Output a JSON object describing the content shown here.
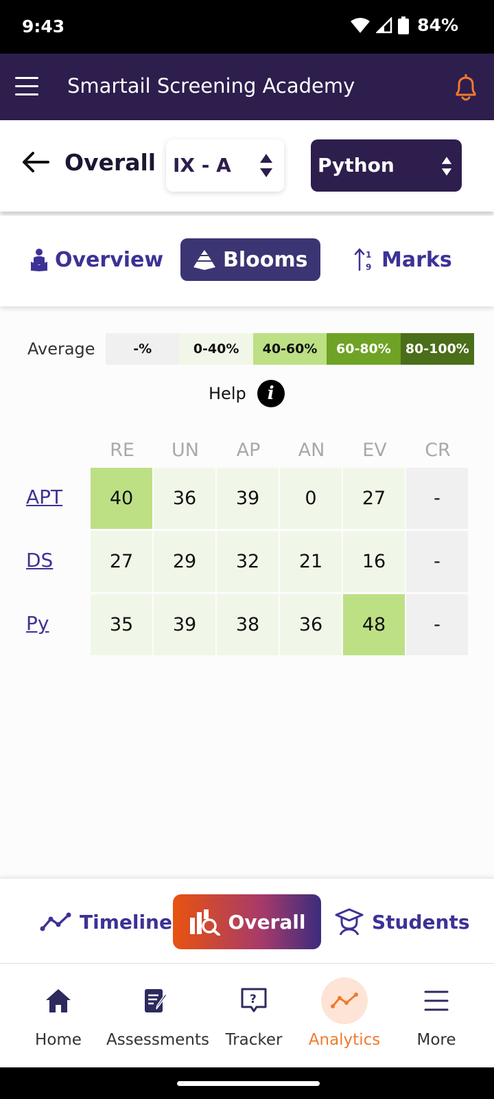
{
  "status_bar": {
    "time": "9:43",
    "battery": "84%"
  },
  "app_bar": {
    "title": "Smartail Screening Academy"
  },
  "filters": {
    "page_title": "Overall",
    "class_value": "IX - A",
    "subject_value": "Python"
  },
  "view_tabs": [
    {
      "label": "Overview",
      "active": false
    },
    {
      "label": "Blooms",
      "active": true
    },
    {
      "label": "Marks",
      "active": false
    }
  ],
  "legend": {
    "label": "Average",
    "ranges": [
      {
        "label": "-%",
        "bg": "#f0f0f0",
        "fg": "#111111"
      },
      {
        "label": "0-40%",
        "bg": "#f1f7e8",
        "fg": "#111111"
      },
      {
        "label": "40-60%",
        "bg": "#bde085",
        "fg": "#111111"
      },
      {
        "label": "60-80%",
        "bg": "#6fa325",
        "fg": "#ffffff"
      },
      {
        "label": "80-100%",
        "bg": "#4a6e1a",
        "fg": "#ffffff"
      }
    ],
    "help_label": "Help"
  },
  "blooms_table": {
    "columns": [
      "RE",
      "UN",
      "AP",
      "AN",
      "EV",
      "CR"
    ],
    "rows": [
      {
        "label": "APT",
        "values": [
          "40",
          "36",
          "39",
          "0",
          "27",
          "-"
        ]
      },
      {
        "label": "DS",
        "values": [
          "27",
          "29",
          "32",
          "21",
          "16",
          "-"
        ]
      },
      {
        "label": "Py",
        "values": [
          "35",
          "39",
          "38",
          "36",
          "48",
          "-"
        ]
      }
    ]
  },
  "segment_tabs": [
    {
      "label": "Timeline",
      "active": false
    },
    {
      "label": "Overall",
      "active": true
    },
    {
      "label": "Students",
      "active": false
    }
  ],
  "bottom_nav": [
    {
      "label": "Home",
      "icon": "home-icon",
      "active": false
    },
    {
      "label": "Assessments",
      "icon": "assessments-icon",
      "active": false
    },
    {
      "label": "Tracker",
      "icon": "tracker-icon",
      "active": false
    },
    {
      "label": "Analytics",
      "icon": "analytics-icon",
      "active": true
    },
    {
      "label": "More",
      "icon": "more-icon",
      "active": false
    }
  ],
  "colors": {
    "primary": "#2d1e4d",
    "accent": "#ef7a2d",
    "link": "#3d3296"
  }
}
